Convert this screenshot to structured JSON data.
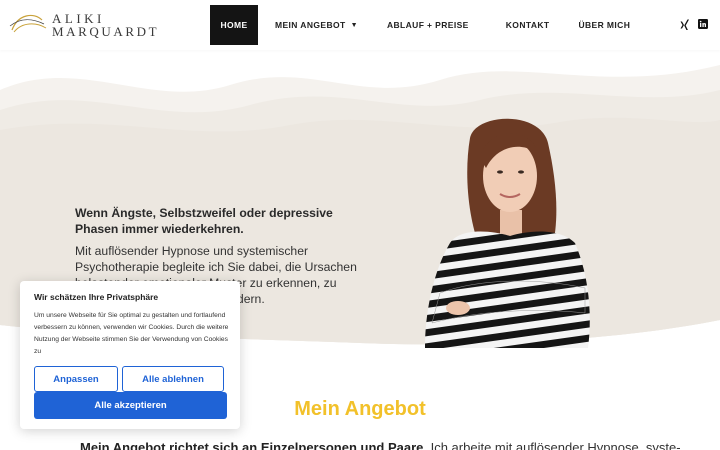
{
  "logo": {
    "line1": "ALIKI",
    "line2": "MARQUARDT"
  },
  "nav": {
    "home": "HOME",
    "angebot": "MEIN ANGEBOT",
    "ablauf": "ABLAUF + PREISE",
    "kontakt": "KONTAKT",
    "ueber": "ÜBER MICH"
  },
  "social": {
    "xing_icon": "xing-icon",
    "linkedin_icon": "linkedin-icon"
  },
  "hero": {
    "headline": "Wenn Ängste, Selbstzweifel oder depressive Phasen immer wiederkehren.",
    "body": "Mit auflösender Hypnose und systemischer Psychotherapie begleite ich Sie dabei, die Ursachen belastender emotionaler Muster zu erkennen, zu lösen und nachhaltig zu verändern."
  },
  "section": {
    "title": "Mein Angebot",
    "intro_bold": "Mein Angebot richtet sich an Einzelpersonen und Paare.",
    "intro_rest": " Ich arbeite mit auflösender Hypnose, syste-"
  },
  "cookie": {
    "title": "Wir schätzen Ihre Privatsphäre",
    "text": "Um unsere Webseite für Sie optimal zu gestalten und fortlaufend verbessern zu können, verwenden wir Cookies. Durch die weitere Nutzung der Webseite stimmen Sie der Verwendung von Cookies zu",
    "customize": "Anpassen",
    "reject": "Alle ablehnen",
    "accept": "Alle akzeptieren"
  },
  "colors": {
    "accent": "#f2c12a",
    "button_blue": "#1f63d6",
    "nav_active": "#141414",
    "hero_bg": "#efebe5"
  }
}
